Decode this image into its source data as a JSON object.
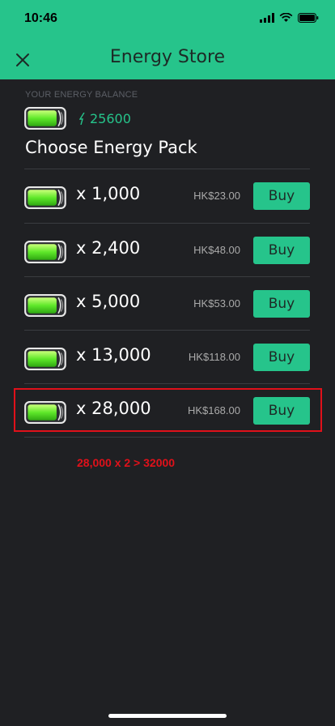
{
  "status": {
    "time": "10:46"
  },
  "header": {
    "title": "Energy Store",
    "close_icon": "close-icon"
  },
  "balance": {
    "caption": "YOUR ENERGY BALANCE",
    "value": "25600"
  },
  "section": {
    "title": "Choose Energy Pack"
  },
  "packs": [
    {
      "amount": "x 1,000",
      "price": "HK$23.00",
      "buy_label": "Buy"
    },
    {
      "amount": "x 2,400",
      "price": "HK$48.00",
      "buy_label": "Buy"
    },
    {
      "amount": "x 5,000",
      "price": "HK$53.00",
      "buy_label": "Buy"
    },
    {
      "amount": "x 13,000",
      "price": "HK$118.00",
      "buy_label": "Buy"
    },
    {
      "amount": "x 28,000",
      "price": "HK$168.00",
      "buy_label": "Buy"
    }
  ],
  "annotation": {
    "text": "28,000 x 2 > 32000",
    "color": "#e0111a"
  },
  "colors": {
    "accent": "#26c48b",
    "background": "#1f2023"
  }
}
